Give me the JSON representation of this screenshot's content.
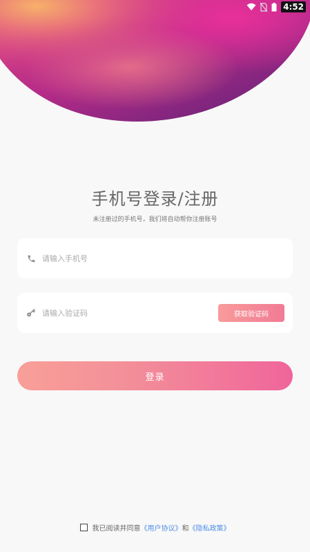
{
  "status_bar": {
    "time": "4:52",
    "icons": [
      "wifi-icon",
      "no-sim-icon",
      "battery-icon"
    ]
  },
  "login": {
    "title": "手机号登录/注册",
    "subtitle": "未注册过的手机号，我们将自动帮你注册账号",
    "phone_placeholder": "请输入手机号",
    "phone_value": "",
    "code_placeholder": "请输入验证码",
    "code_value": "",
    "get_code_label": "获取验证码",
    "submit_label": "登录"
  },
  "agreement": {
    "checked": false,
    "prefix": "我已阅读并同意",
    "user_agreement": "《用户协议》",
    "conjunction": "和",
    "privacy_policy": "《隐私政策》"
  },
  "colors": {
    "background": "#f8f8f8",
    "accent_start": "#f99f98",
    "accent_end": "#f0659a",
    "link": "#4f8ee6"
  }
}
